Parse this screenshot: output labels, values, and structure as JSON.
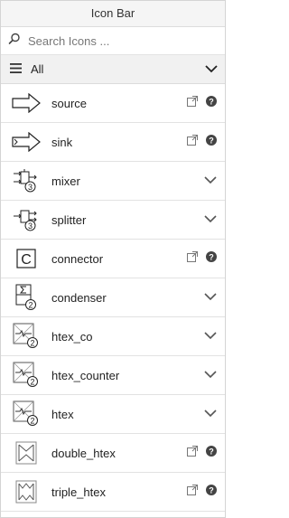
{
  "title": "Icon Bar",
  "search": {
    "placeholder": "Search Icons ..."
  },
  "filter": {
    "label": "All"
  },
  "items": [
    {
      "name": "source",
      "icon": "source-arrow-icon",
      "trailing": "actions"
    },
    {
      "name": "sink",
      "icon": "sink-arrow-icon",
      "trailing": "actions"
    },
    {
      "name": "mixer",
      "icon": "mixer-icon",
      "trailing": "expand"
    },
    {
      "name": "splitter",
      "icon": "splitter-icon",
      "trailing": "expand"
    },
    {
      "name": "connector",
      "icon": "connector-icon",
      "trailing": "actions"
    },
    {
      "name": "condenser",
      "icon": "condenser-icon",
      "trailing": "expand"
    },
    {
      "name": "htex_co",
      "icon": "htex-co-icon",
      "trailing": "expand"
    },
    {
      "name": "htex_counter",
      "icon": "htex-counter-icon",
      "trailing": "expand"
    },
    {
      "name": "htex",
      "icon": "htex-icon",
      "trailing": "expand"
    },
    {
      "name": "double_htex",
      "icon": "double-htex-icon",
      "trailing": "actions"
    },
    {
      "name": "triple_htex",
      "icon": "triple-htex-icon",
      "trailing": "actions"
    }
  ],
  "badges": {
    "mixer": "3",
    "splitter": "3",
    "condenser": "2",
    "htex_co": "2",
    "htex_counter": "2",
    "htex": "2"
  }
}
